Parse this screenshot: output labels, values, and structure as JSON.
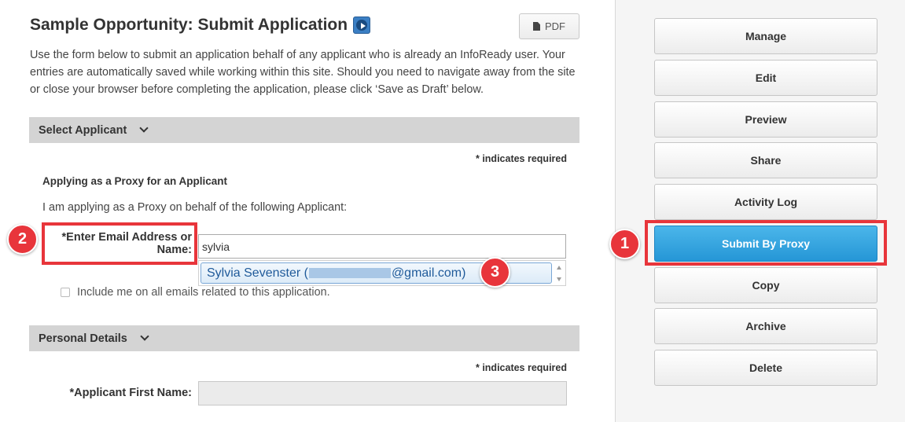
{
  "header": {
    "title": "Sample Opportunity: Submit Application",
    "pdf_label": "PDF",
    "intro": "Use the form below to submit an application behalf of any applicant who is already an InfoReady user. Your entries are automatically saved while working within this site. Should you need to navigate away from the site or close your browser before completing the application, please click ‘Save as Draft’ below."
  },
  "select_applicant": {
    "section_label": "Select Applicant",
    "required_note": "* indicates required",
    "proxy_heading": "Applying as a Proxy for an Applicant",
    "proxy_description": "I am applying as a Proxy on behalf of the following Applicant:",
    "email_label": "*Enter Email Address or Name:",
    "email_value": "sylvia",
    "suggestion_name": "Sylvia Sevenster (",
    "suggestion_email_suffix": "@gmail.com)",
    "include_label": "Include me on all emails related to this application."
  },
  "personal_details": {
    "section_label": "Personal Details",
    "required_note": "* indicates required",
    "first_name_label": "*Applicant First Name:",
    "first_name_value": ""
  },
  "sidebar": {
    "buttons": [
      {
        "label": "Manage"
      },
      {
        "label": "Edit"
      },
      {
        "label": "Preview"
      },
      {
        "label": "Share"
      },
      {
        "label": "Activity Log"
      },
      {
        "label": "Submit By Proxy"
      },
      {
        "label": "Copy"
      },
      {
        "label": "Archive"
      },
      {
        "label": "Delete"
      }
    ]
  },
  "callouts": [
    "1",
    "2",
    "3"
  ],
  "colors": {
    "primary_button": "#2596d6",
    "highlight": "#e8353b",
    "section_bar": "#d4d4d4"
  }
}
